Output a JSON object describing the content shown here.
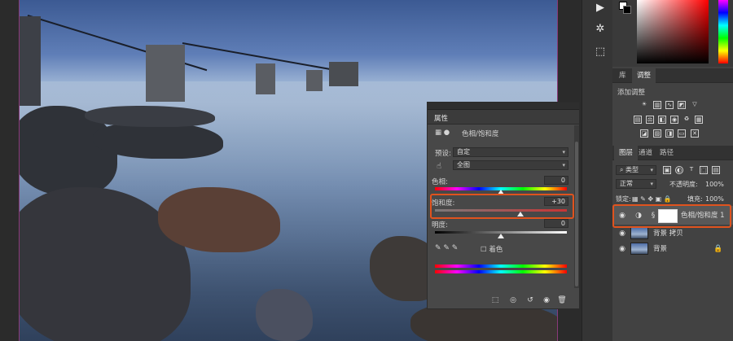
{
  "colors": {
    "accent_highlight": "#e0531e",
    "panel_bg": "#424242",
    "dialog_bg": "#484848",
    "canvas_border": "#8a3a7a"
  },
  "panel_tabs_top": [
    {
      "label": "库"
    },
    {
      "label": "调整"
    }
  ],
  "adjustments": {
    "title": "添加调整",
    "icons": [
      "brightness-icon",
      "levels-icon",
      "curves-icon",
      "exposure-icon",
      "vibrance-icon",
      "hue-saturation-icon",
      "color-balance-icon",
      "black-white-icon",
      "photo-filter-icon",
      "channel-mixer-icon",
      "color-lookup-icon",
      "invert-icon",
      "posterize-icon",
      "threshold-icon",
      "gradient-map-icon",
      "selective-color-icon"
    ]
  },
  "properties": {
    "title": "属性",
    "adjustment_name": "色相/饱和度",
    "preset_label": "预设:",
    "preset_value": "自定",
    "channel_value": "全图",
    "hue": {
      "label": "色相:",
      "value": "0",
      "fraction": 0.5
    },
    "saturation": {
      "label": "饱和度:",
      "value": "+30",
      "fraction": 0.65
    },
    "lightness": {
      "label": "明度:",
      "value": "0",
      "fraction": 0.5
    },
    "colorize_label": "着色"
  },
  "layers_panel": {
    "tabs": [
      {
        "label": "图层"
      },
      {
        "label": "通道"
      },
      {
        "label": "路径"
      }
    ],
    "filter_label": "类型",
    "blend_mode": "正常",
    "opacity_label": "不透明度:",
    "opacity_value": "100%",
    "lock_label": "锁定:",
    "fill_label": "填充:",
    "fill_value": "100%",
    "layers": [
      {
        "name": "色相/饱和度 1",
        "selected": true
      },
      {
        "name": "背景 拷贝",
        "selected": false
      },
      {
        "name": "背景",
        "selected": false
      }
    ]
  }
}
